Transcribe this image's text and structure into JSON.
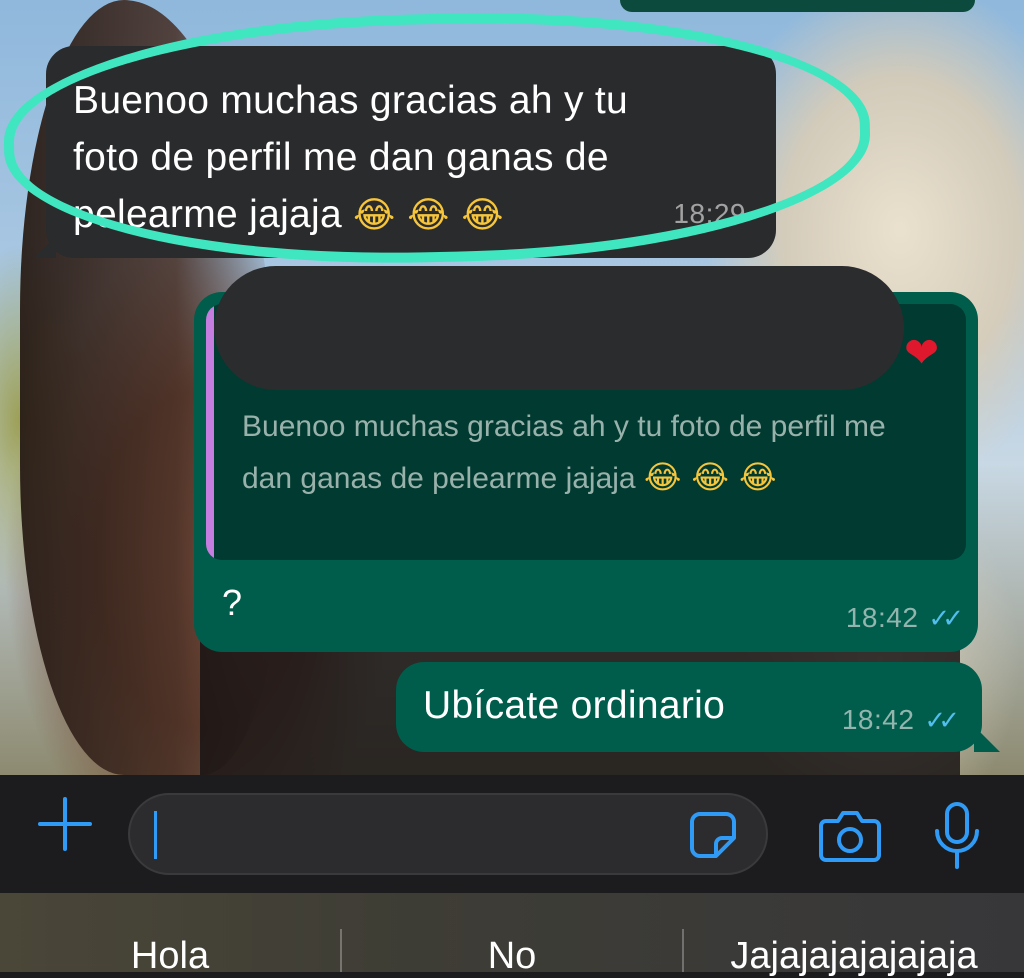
{
  "messages": [
    {
      "direction": "incoming",
      "text": "Buenoo muchas gracias ah y tu foto de perfil me dan ganas de pelearme jajaja",
      "emoji": "😂 😂 😂",
      "time": "18:29"
    },
    {
      "direction": "outgoing",
      "quoted_text": "Buenoo muchas gracias ah y tu foto de perfil me dan ganas de pelearme jajaja",
      "quoted_emoji": "😂 😂 😂",
      "reaction": "❤",
      "text": "?",
      "time": "18:42",
      "status": "✓✓"
    },
    {
      "direction": "outgoing",
      "text": "Ubícate ordinario",
      "time": "18:42",
      "status": "✓✓"
    }
  ],
  "composer": {
    "input_value": "",
    "icons": [
      "plus-icon",
      "sticker-icon",
      "camera-icon",
      "microphone-icon"
    ]
  },
  "suggestions": [
    "Hola",
    "No",
    "Jajajajajajajaja"
  ],
  "colors": {
    "incoming_bubble": "#2a2b2d",
    "outgoing_bubble": "#005c4b",
    "accent": "#2f9bf6",
    "read_ticks": "#53bdeb",
    "highlight": "#3fe6bf"
  }
}
